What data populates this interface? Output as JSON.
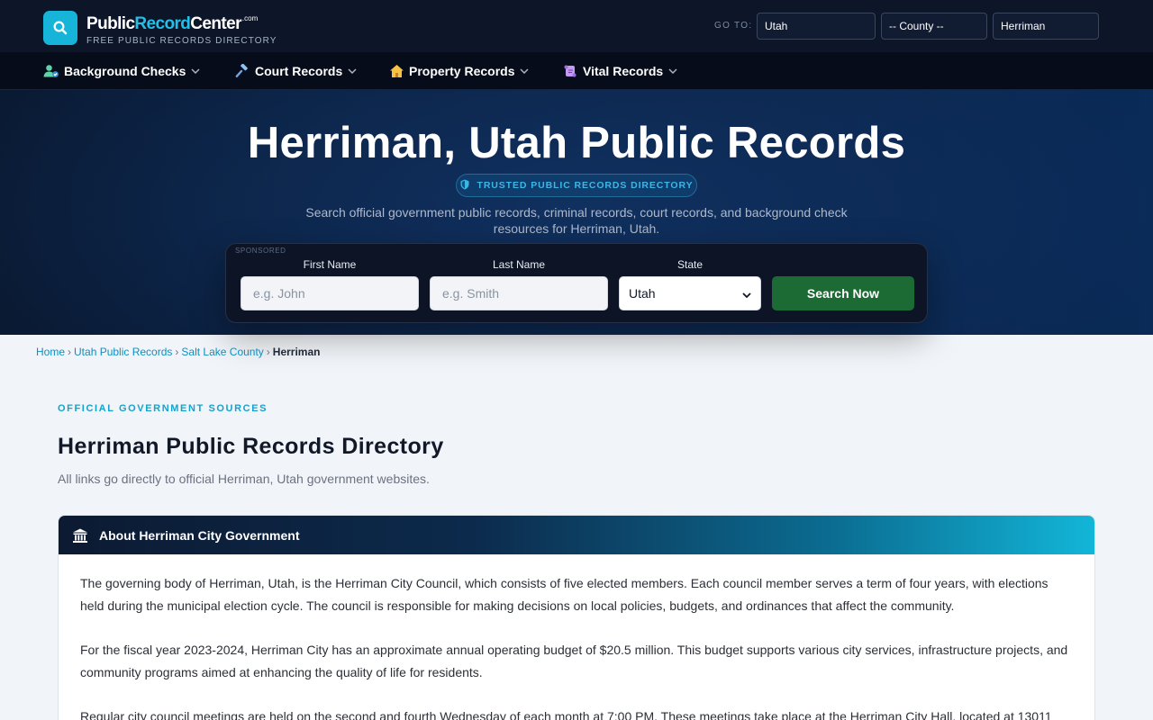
{
  "brand": {
    "name_part1": "Public",
    "name_part2": "Record",
    "name_part3": "Center",
    "tld": ".com",
    "tagline": "FREE PUBLIC RECORDS DIRECTORY",
    "accent_color": "#16b4d8"
  },
  "goto": {
    "label": "GO TO:",
    "state": "Utah",
    "county": "-- County --",
    "city": "Herriman"
  },
  "nav": {
    "items": [
      {
        "label": "Background Checks",
        "icon": "user-check-icon"
      },
      {
        "label": "Court Records",
        "icon": "gavel-icon"
      },
      {
        "label": "Property Records",
        "icon": "house-icon"
      },
      {
        "label": "Vital Records",
        "icon": "scroll-icon"
      }
    ]
  },
  "hero": {
    "title": "Herriman, Utah Public Records",
    "badge": "TRUSTED PUBLIC RECORDS DIRECTORY",
    "subtitle": "Search official government public records, criminal records, court records, and background check resources for Herriman, Utah."
  },
  "search": {
    "sponsored": "SPONSORED",
    "first_name_label": "First Name",
    "first_name_placeholder": "e.g. John",
    "last_name_label": "Last Name",
    "last_name_placeholder": "e.g. Smith",
    "state_label": "State",
    "state_value": "Utah",
    "button_label": "Search Now",
    "button_color": "#1c6a34"
  },
  "breadcrumb": {
    "home": "Home",
    "state": "Utah Public Records",
    "county": "Salt Lake County",
    "current": "Herriman",
    "separator": "›"
  },
  "main": {
    "eyebrow": "OFFICIAL GOVERNMENT SOURCES",
    "title": "Herriman Public Records Directory",
    "subtitle": "All links go directly to official Herriman, Utah government websites.",
    "card": {
      "title": "About Herriman City Government",
      "paragraphs": [
        "The governing body of Herriman, Utah, is the Herriman City Council, which consists of five elected members. Each council member serves a term of four years, with elections held during the municipal election cycle. The council is responsible for making decisions on local policies, budgets, and ordinances that affect the community.",
        "For the fiscal year 2023-2024, Herriman City has an approximate annual operating budget of $20.5 million. This budget supports various city services, infrastructure projects, and community programs aimed at enhancing the quality of life for residents.",
        "Regular city council meetings are held on the second and fourth Wednesday of each month at 7:00 PM. These meetings take place at the Herriman City Hall, located at 13011"
      ]
    }
  }
}
